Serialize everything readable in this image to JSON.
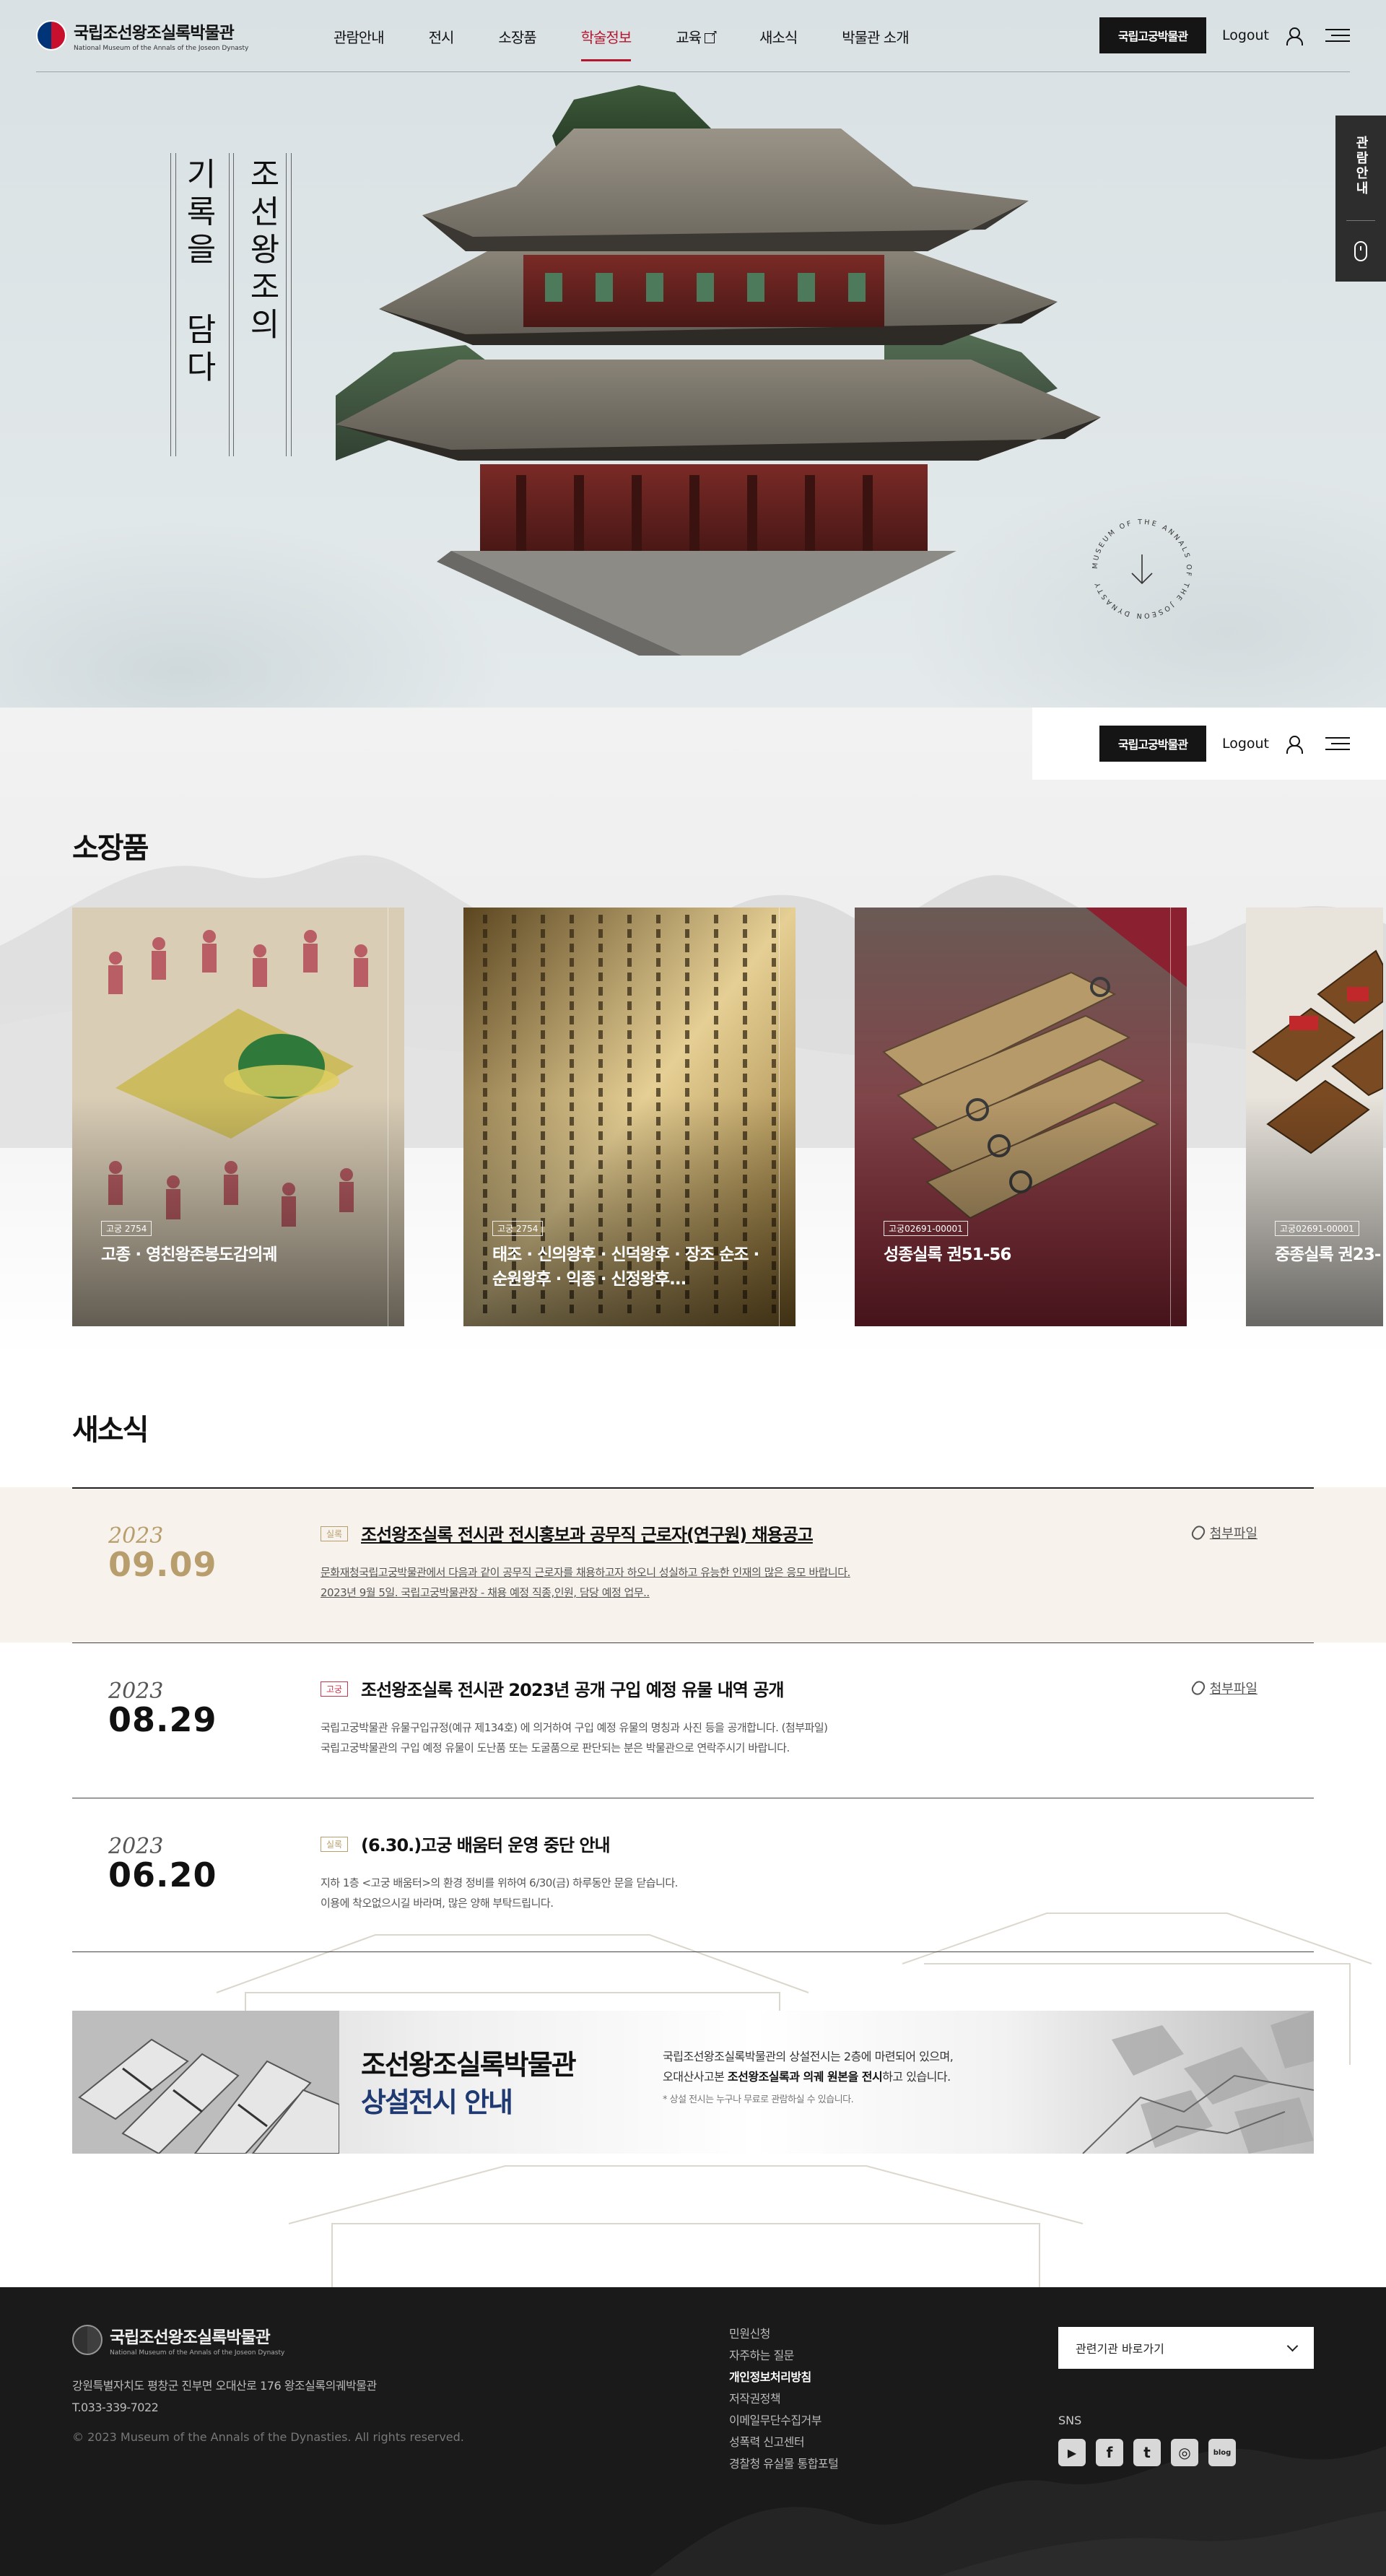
{
  "header": {
    "logo_ko": "국립조선왕조실록박물관",
    "logo_en": "National Museum of the Annals of the Joseon Dynasty",
    "nav": [
      {
        "label": "관람안내",
        "active": false
      },
      {
        "label": "전시",
        "active": false
      },
      {
        "label": "소장품",
        "active": false
      },
      {
        "label": "학술정보",
        "active": true
      },
      {
        "label": "교육",
        "active": false,
        "external": true
      },
      {
        "label": "새소식",
        "active": false
      },
      {
        "label": "박물관 소개",
        "active": false
      }
    ],
    "palace_button": "국립고궁박물관",
    "logout": "Logout"
  },
  "hero": {
    "title_col1": "조선왕조의",
    "title_col2": "기록을 담다",
    "badge_text": "MUSEUM OF THE ANNALS OF THE JOSEON DYNASTY",
    "quick_label": "관람안내"
  },
  "collection": {
    "title": "소장품",
    "cards": [
      {
        "tag": "고궁 2754",
        "title": "고종 · 영친왕존봉도감의궤"
      },
      {
        "tag": "고궁 2754",
        "title": "태조 · 신의왕후 · 신덕왕후 · 장조 순조 · 순원왕후 · 익종 · 신정왕후..."
      },
      {
        "tag": "고궁02691-00001",
        "title": "성종실록 권51-56"
      },
      {
        "tag": "고궁02691-00001",
        "title": "중종실록 권23-"
      }
    ]
  },
  "news": {
    "title": "새소식",
    "items": [
      {
        "year": "2023",
        "date": "09.09",
        "badge": "실록",
        "title": "조선왕조실록 전시관 전시홍보과 공무직 근로자(연구원) 채용공고",
        "desc1": "문화재청국립고궁박물관에서 다음과 같이 공무직 근로자를 채용하고자 하오니 성실하고 유능한 인재의 많은 응모 바랍니다.",
        "desc2": "2023년 9월 5일. 국립고궁박물관장 - 채용 예정 직종,인원, 담당 예정 업무..",
        "attach": "첨부파일"
      },
      {
        "year": "2023",
        "date": "08.29",
        "badge": "고궁",
        "title": "조선왕조실록 전시관 2023년 공개 구입 예정 유물 내역 공개",
        "desc1": "국립고궁박물관 유물구입규정(예규 제134호) 에 의거하여 구입 예정 유물의 명칭과 사진 등을 공개합니다. (첨부파일)",
        "desc2": "국립고궁박물관의 구입 예정 유물이 도난품 또는 도굴품으로 판단되는 분은 박물관으로 연락주시기 바랍니다.",
        "attach": "첨부파일"
      },
      {
        "year": "2023",
        "date": "06.20",
        "badge": "실록",
        "title": "(6.30.)고궁 배움터 운영 중단 안내",
        "desc1": "지하 1층 <고궁 배움터>의 환경 정비를 위하여 6/30(금) 하루동안 문을 닫습니다.",
        "desc2": "이용에 착오없으시길 바라며, 많은 양해 부탁드립니다.",
        "attach": ""
      }
    ]
  },
  "banner": {
    "title1": "조선왕조실록박물관",
    "title2": "상설전시 안내",
    "desc1": "국립조선왕조실록박물관의 상설전시는 2층에 마련되어 있으며,",
    "desc2_pre": "오대산사고본 ",
    "desc2_bold": "조선왕조실록과 의궤 원본을 전시",
    "desc2_post": "하고 있습니다.",
    "note": "* 상설 전시는 누구나 무료로 관람하실 수 있습니다."
  },
  "footer": {
    "logo_ko": "국립조선왕조실록박물관",
    "logo_en": "National Museum of the Annals of the Joseon Dynasty",
    "address": "강원특별자치도 평창군 진부면 오대산로 176 왕조실록의궤박물관",
    "tel": "T.033-339-7022",
    "copyright": "© 2023 Museum of the Annals of the Dynasties. All rights reserved.",
    "links": [
      {
        "label": "민원신청",
        "strong": false
      },
      {
        "label": "자주하는 질문",
        "strong": false
      },
      {
        "label": "개인정보처리방침",
        "strong": true
      },
      {
        "label": "저작권정책",
        "strong": false
      },
      {
        "label": "이메일무단수집거부",
        "strong": false
      },
      {
        "label": "성폭력 신고센터",
        "strong": false
      },
      {
        "label": "경찰청 유실물 통합포털",
        "strong": false
      }
    ],
    "related_select": "관련기관 바로가기",
    "sns_label": "SNS",
    "sns": [
      {
        "icon": "youtube-icon",
        "glyph": "▶"
      },
      {
        "icon": "facebook-icon",
        "glyph": "f"
      },
      {
        "icon": "twitter-icon",
        "glyph": "t"
      },
      {
        "icon": "instagram-icon",
        "glyph": "◎"
      },
      {
        "icon": "blog-icon",
        "glyph": "blog"
      }
    ]
  }
}
